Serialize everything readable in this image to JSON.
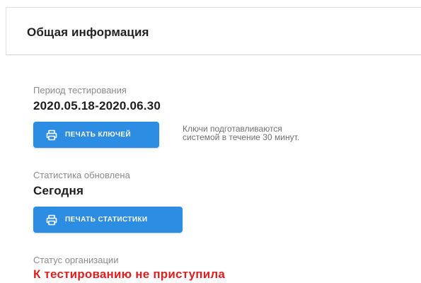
{
  "panel": {
    "title": "Общая информация"
  },
  "testing_period": {
    "label": "Период тестирования",
    "value": "2020.05.18-2020.06.30",
    "print_keys_button": "ПЕЧАТЬ КЛЮЧЕЙ",
    "hint_line1": "Ключи подготавливаются",
    "hint_line2": "системой в течение 30 минут."
  },
  "statistics": {
    "label": "Статистика обновлена",
    "value": "Сегодня",
    "print_stats_button": "ПЕЧАТЬ СТАТИСТИКИ"
  },
  "organization_status": {
    "label": "Статус организации",
    "value": "К тестированию не приступила"
  },
  "colors": {
    "button_bg": "#2d8de2",
    "status_text": "#e02020",
    "label_text": "#8a8a8a"
  },
  "icons": {
    "print": "printer-icon"
  }
}
